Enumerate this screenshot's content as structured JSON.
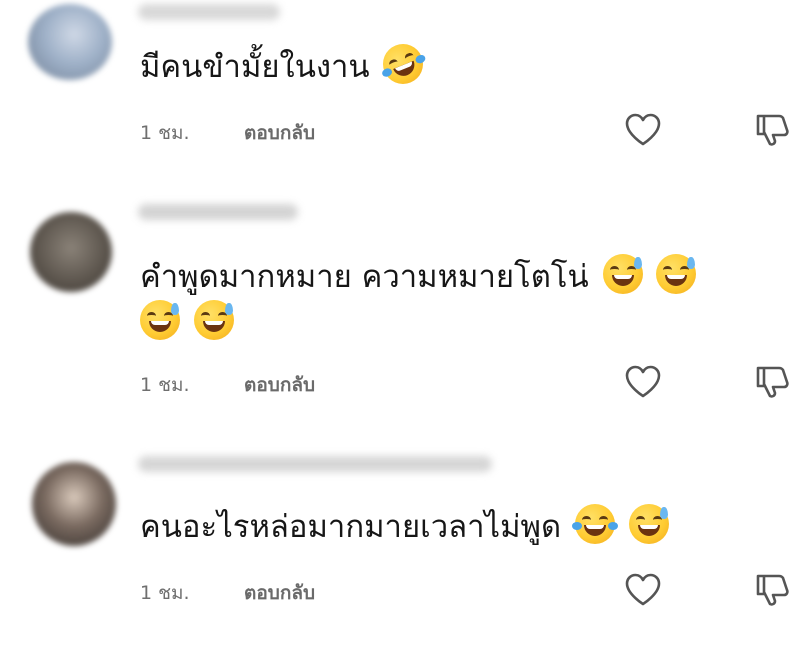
{
  "comments": [
    {
      "text": "มีคนขำมั้ยในงาน",
      "emojis": [
        "rolling-on-floor-laughing"
      ],
      "time": "1 ชม.",
      "reply_label": "ตอบกลับ"
    },
    {
      "text": "คำพูดมากหมาย ความหมายโตโน่",
      "emojis": [
        "grinning-face-with-sweat",
        "grinning-face-with-sweat",
        "grinning-face-with-sweat",
        "grinning-face-with-sweat"
      ],
      "time": "1 ชม.",
      "reply_label": "ตอบกลับ"
    },
    {
      "text": "คนอะไรหล่อมากมายเวลาไม่พูด",
      "emojis": [
        "face-with-tears-of-joy",
        "grinning-face-with-sweat"
      ],
      "time": "1 ชม.",
      "reply_label": "ตอบกลับ"
    }
  ],
  "icons": {
    "like": "heart-outline-icon",
    "dislike": "thumbs-down-outline-icon"
  },
  "colors": {
    "text": "#161616",
    "meta": "#6f6f6f",
    "icon_stroke": "#555555",
    "emoji_yellow": "#ffcc33"
  }
}
